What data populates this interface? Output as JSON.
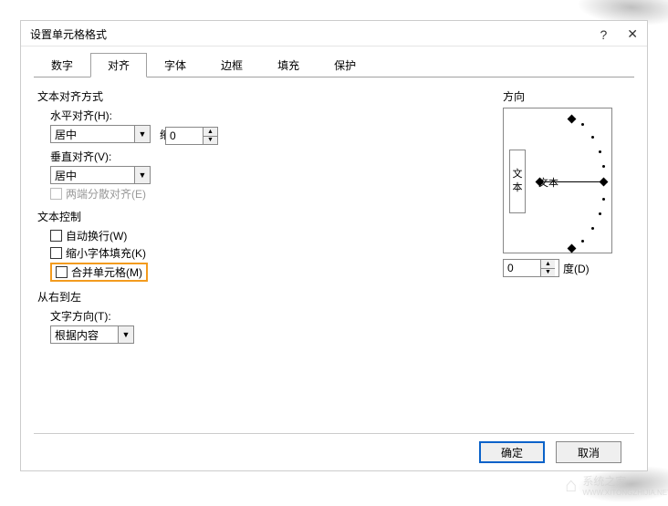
{
  "title": "设置单元格格式",
  "help_symbol": "?",
  "close_symbol": "✕",
  "tabs": [
    "数字",
    "对齐",
    "字体",
    "边框",
    "填充",
    "保护"
  ],
  "active_tab_index": 1,
  "text_align": {
    "section": "文本对齐方式",
    "horizontal_label": "水平对齐(H):",
    "horizontal_value": "居中",
    "indent_label": "缩进(I):",
    "indent_value": "0",
    "vertical_label": "垂直对齐(V):",
    "vertical_value": "居中",
    "justify_distributed_label": "两端分散对齐(E)"
  },
  "text_control": {
    "section": "文本控制",
    "wrap_label": "自动换行(W)",
    "shrink_label": "缩小字体填充(K)",
    "merge_label": "合并单元格(M)"
  },
  "rtl": {
    "section": "从右到左",
    "direction_label": "文字方向(T):",
    "direction_value": "根据内容"
  },
  "orientation": {
    "section": "方向",
    "vertical_text": "文本",
    "dial_text": "文本",
    "degree_value": "0",
    "degree_label": "度(D)"
  },
  "buttons": {
    "ok": "确定",
    "cancel": "取消"
  },
  "watermark": {
    "site": "系统之家",
    "url": "WWW.XITONGZHIJIA.NET"
  }
}
